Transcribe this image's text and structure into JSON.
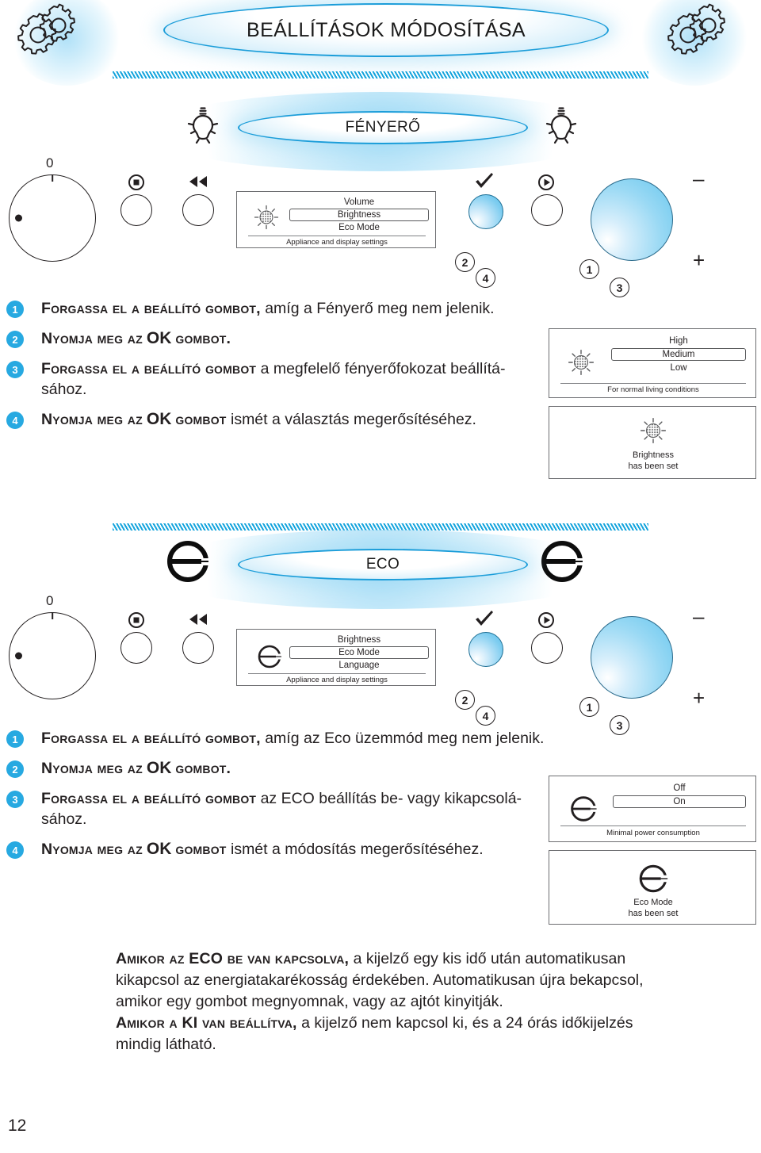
{
  "page": {
    "number": "12",
    "title": "BEÁLLÍTÁSOK MÓDOSÍTÁSA"
  },
  "sections": [
    {
      "id": "brightness",
      "heading": "FÉNYERŐ",
      "heading_icon": "lightbulb-icon",
      "panel": {
        "knob_zero_label": "0",
        "stop_icon": "stop-button-icon",
        "rewind_icon": "rewind-icon",
        "check_icon": "checkmark-icon",
        "play_icon": "play-button-icon",
        "minus_label": "–",
        "plus_label": "+",
        "step_markers": [
          "2",
          "4",
          "1",
          "3"
        ]
      },
      "display": {
        "icon": "sun-brightness-icon",
        "rows": [
          "Volume",
          "Brightness",
          "Eco Mode"
        ],
        "selected": "Brightness",
        "footer": "Appliance and display settings"
      },
      "steps": [
        {
          "num": "1",
          "caps": "Forgassa el a beállító gombot,",
          "rest": " amíg a Fényerő meg nem jelenik."
        },
        {
          "num": "2",
          "caps": "Nyomja meg az",
          "strong": "OK",
          "caps2": "gombot.",
          "rest": ""
        },
        {
          "num": "3",
          "caps": "Forgassa el a beállító gombot",
          "rest": " a megfelelő fényerőfokozat beállítá-sához."
        },
        {
          "num": "4",
          "caps": "Nyomja meg az",
          "strong": "OK",
          "caps2": "gombot",
          "rest": " ismét a választás megerősítéséhez."
        }
      ],
      "result_displays": [
        {
          "icon": "sun-brightness-icon",
          "rows": [
            "High",
            "Medium",
            "Low"
          ],
          "selected": "Medium",
          "footer": "For normal living conditions"
        },
        {
          "icon": "sun-brightness-icon",
          "lines": [
            "Brightness",
            "has been set"
          ]
        }
      ]
    },
    {
      "id": "eco",
      "heading": "ECO",
      "heading_icon": "eco-e-icon",
      "panel": {
        "knob_zero_label": "0",
        "stop_icon": "stop-button-icon",
        "rewind_icon": "rewind-icon",
        "check_icon": "checkmark-icon",
        "play_icon": "play-button-icon",
        "minus_label": "–",
        "plus_label": "+",
        "step_markers": [
          "2",
          "4",
          "1",
          "3"
        ]
      },
      "display": {
        "icon": "eco-e-icon",
        "rows": [
          "Brightness",
          "Eco Mode",
          "Language"
        ],
        "selected": "Eco Mode",
        "footer": "Appliance and display settings"
      },
      "steps": [
        {
          "num": "1",
          "caps": "Forgassa el a beállító gombot,",
          "rest": " amíg az Eco üzemmód meg nem jelenik."
        },
        {
          "num": "2",
          "caps": "Nyomja meg az",
          "strong": "OK",
          "caps2": "gombot.",
          "rest": ""
        },
        {
          "num": "3",
          "caps": "Forgassa el a beállító gombot",
          "rest": " az ECO beállítás be- vagy kikapcsolá-sához."
        },
        {
          "num": "4",
          "caps": "Nyomja meg az",
          "strong": "OK",
          "caps2": "gombot",
          "rest": " ismét a módosítás megerősítéséhez."
        }
      ],
      "result_displays": [
        {
          "icon": "eco-e-icon",
          "rows": [
            "Off",
            "On"
          ],
          "selected": "On",
          "footer": "Minimal power consumption"
        },
        {
          "icon": "eco-e-icon",
          "lines": [
            "Eco Mode",
            "has been set"
          ]
        }
      ]
    }
  ],
  "note": {
    "p1_caps": "Amikor az ECO be van kapcsolva,",
    "p1_rest": " a kijelző egy kis idő után automatikusan kikapcsol az energiatakarékosság érdekében. Automatikusan újra bekapcsol, amikor egy gombot megnyomnak, vagy az ajtót kinyitják.",
    "p2_caps": "Amikor a KI van beállítva,",
    "p2_rest": " a kijelző nem kapcsol ki, és a 24 órás időkijelzés mindig látható."
  },
  "colors": {
    "accent": "#27a9e1",
    "accent_dark": "#1b9dd9",
    "text": "#231f20",
    "lcd_border": "#6d6e71"
  }
}
